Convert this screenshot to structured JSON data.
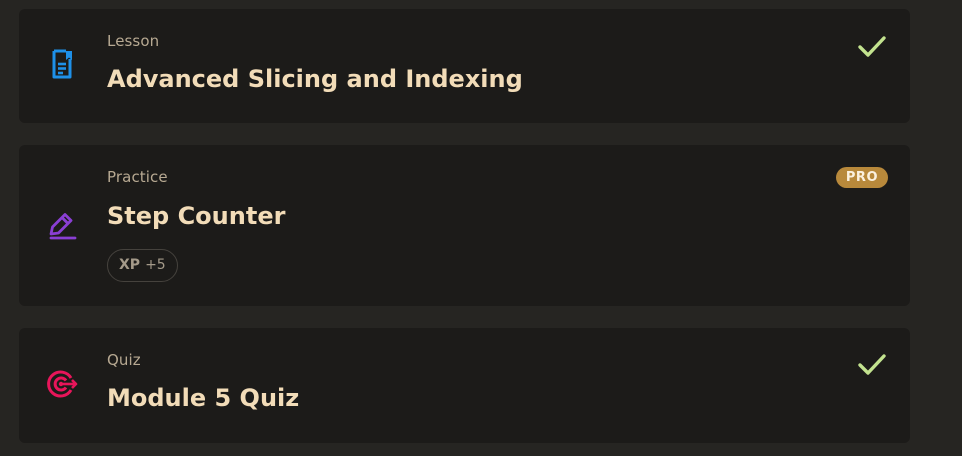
{
  "items": [
    {
      "type": "Lesson",
      "title": "Advanced Slicing and Indexing",
      "icon": "lesson-document-icon",
      "icon_color": "#1e90e8",
      "completed": true
    },
    {
      "type": "Practice",
      "title": "Step Counter",
      "icon": "practice-pencil-icon",
      "icon_color": "#8a3fd4",
      "completed": false,
      "badge": "PRO",
      "xp_label": "XP",
      "xp_value": "+5"
    },
    {
      "type": "Quiz",
      "title": "Module 5 Quiz",
      "icon": "quiz-target-icon",
      "icon_color": "#e8155a",
      "completed": true
    }
  ],
  "colors": {
    "background": "#262522",
    "card": "#1c1b19",
    "title": "#f2dcb8",
    "type_label": "#b7a992",
    "check": "#c3e38f",
    "pro_badge": "#b8893b"
  }
}
